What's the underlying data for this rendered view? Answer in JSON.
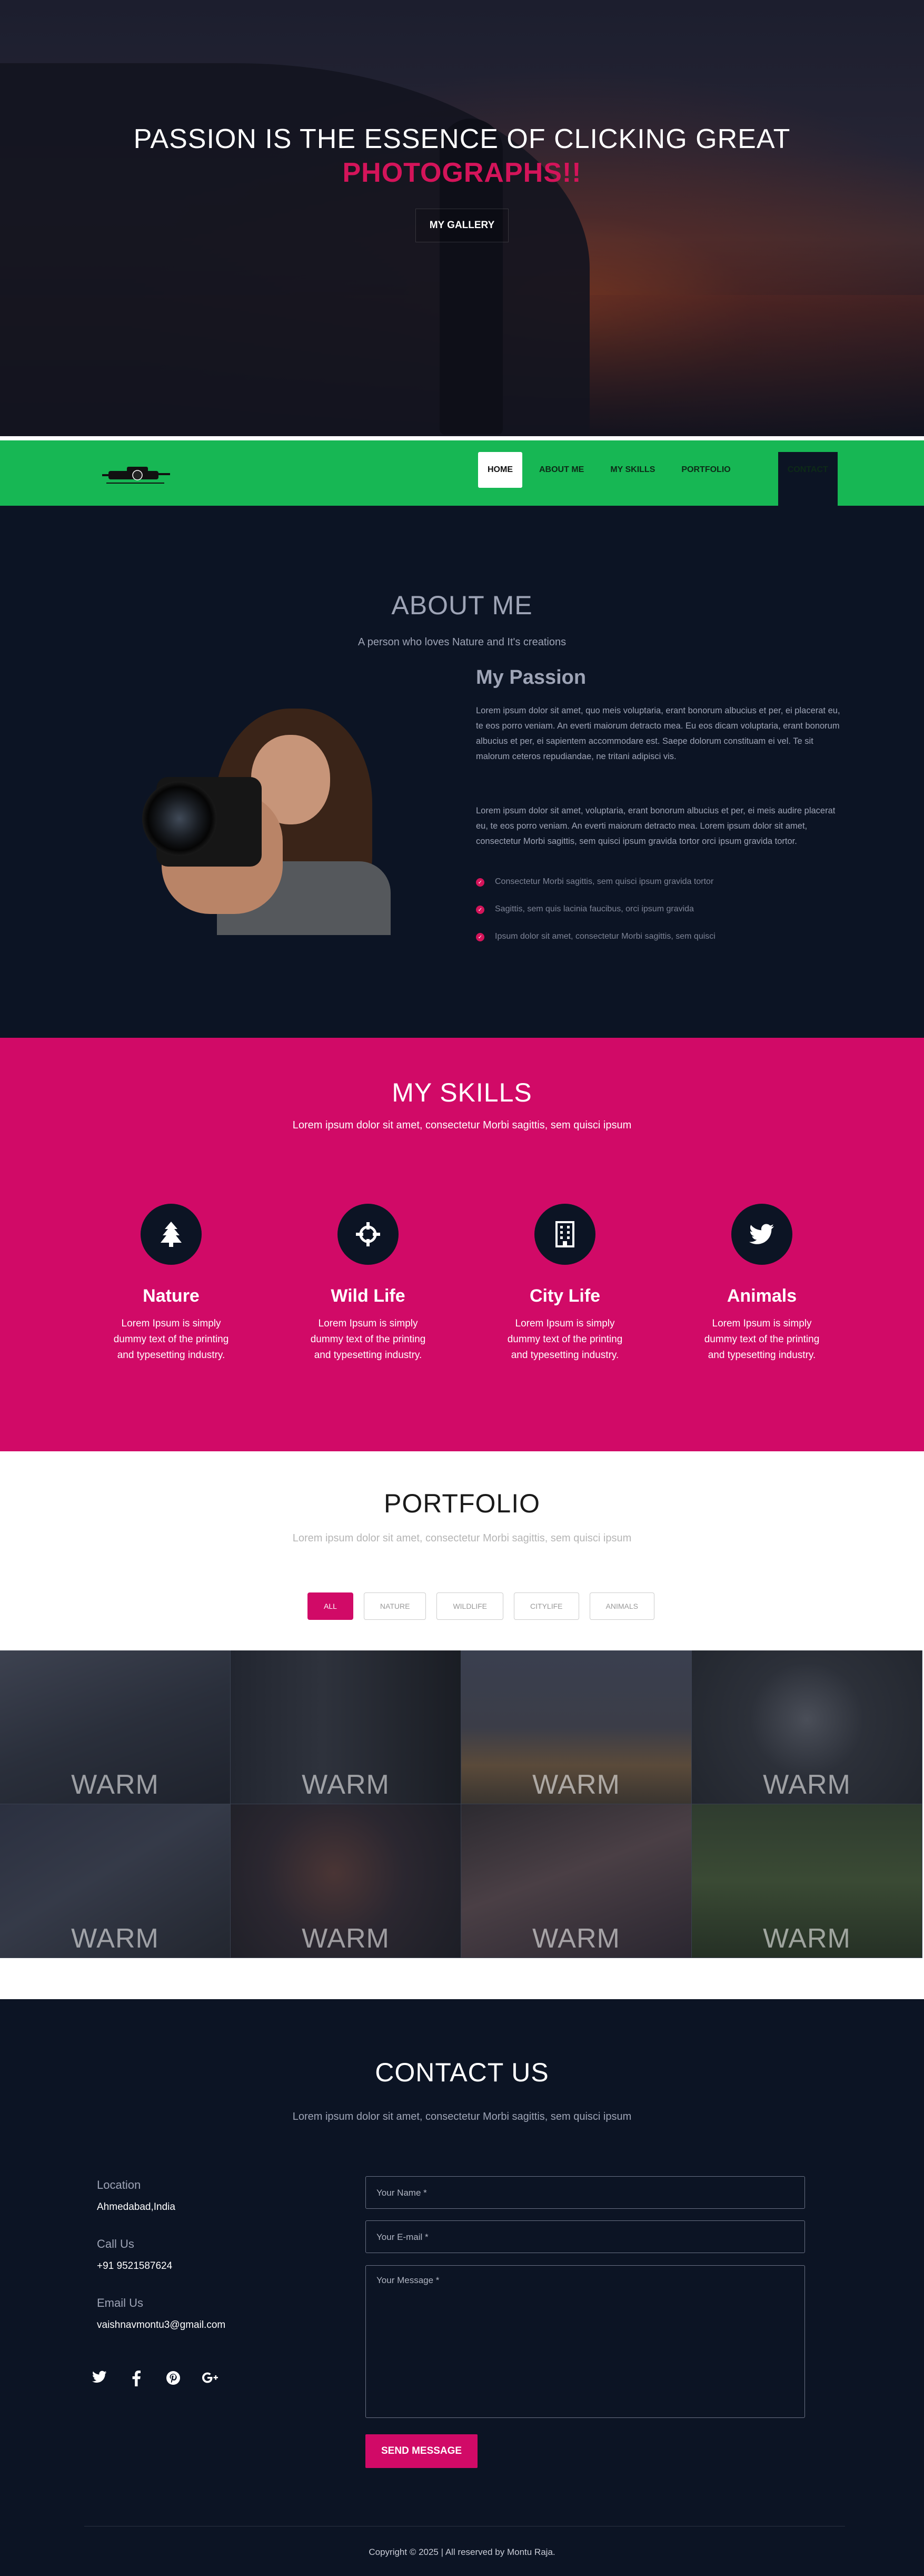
{
  "hero": {
    "line1": "PASSION IS THE ESSENCE OF CLICKING GREAT",
    "line2": "PHOTOGRAPHS!!",
    "button": "MY GALLERY"
  },
  "nav": {
    "items": [
      "HOME",
      "ABOUT ME",
      "MY SKILLS",
      "PORTFOLIO",
      "CONTACT"
    ],
    "active": "HOME"
  },
  "about": {
    "title": "ABOUT ME",
    "subtitle": "A person who loves Nature and It's creations",
    "heading": "My Passion",
    "para1": "Lorem ipsum dolor sit amet, quo meis voluptaria, erant bonorum albucius et per, ei placerat eu, te eos porro veniam. An everti maiorum detracto mea. Eu eos dicam voluptaria, erant bonorum albucius et per, ei sapientem accommodare est. Saepe dolorum constituam ei vel. Te sit malorum ceteros repudiandae, ne tritani adipisci vis.",
    "para2": "Lorem ipsum dolor sit amet, voluptaria, erant bonorum albucius et per, ei meis audire placerat eu, te eos porro veniam. An everti maiorum detracto mea. Lorem ipsum dolor sit amet, consectetur Morbi sagittis, sem quisci ipsum gravida tortor orci ipsum gravida tortor.",
    "checks": [
      "Consectetur Morbi sagittis, sem quisci ipsum gravida tortor",
      "Sagittis, sem quis lacinia faucibus, orci ipsum gravida",
      "Ipsum dolor sit amet, consectetur Morbi sagittis, sem quisci"
    ]
  },
  "skills": {
    "title": "MY SKILLS",
    "subtitle": "Lorem ipsum dolor sit amet, consectetur Morbi sagittis, sem quisci ipsum",
    "items": [
      {
        "title": "Nature",
        "icon": "tree-icon",
        "desc": "Lorem Ipsum is simply dummy text of the printing and typesetting industry."
      },
      {
        "title": "Wild Life",
        "icon": "crosshair-icon",
        "desc": "Lorem Ipsum is simply dummy text of the printing and typesetting industry."
      },
      {
        "title": "City Life",
        "icon": "building-icon",
        "desc": "Lorem Ipsum is simply dummy text of the printing and typesetting industry."
      },
      {
        "title": "Animals",
        "icon": "twitter-bird-icon",
        "desc": "Lorem Ipsum is simply dummy text of the printing and typesetting industry."
      }
    ]
  },
  "portfolio": {
    "title": "PORTFOLIO",
    "subtitle": "Lorem ipsum dolor sit amet, consectetur Morbi sagittis, sem quisci ipsum",
    "filters": [
      "ALL",
      "NATURE",
      "WILDLIFE",
      "CITYLIFE",
      "ANIMALS"
    ],
    "active_filter": "ALL",
    "tiles": [
      "WARM",
      "WARM",
      "WARM",
      "WARM",
      "WARM",
      "WARM",
      "WARM",
      "WARM"
    ]
  },
  "contact": {
    "title": "CONTACT US",
    "subtitle": "Lorem ipsum dolor sit amet, consectetur Morbi sagittis, sem quisci ipsum",
    "location_label": "Location",
    "location": "Ahmedabad,India",
    "call_label": "Call Us",
    "phone": "+91 9521587624",
    "email_label": "Email Us",
    "email": "vaishnavmontu3@gmail.com",
    "name_placeholder": "Your Name *",
    "email_placeholder": "Your E-mail *",
    "message_placeholder": "Your Message *",
    "send": "SEND MESSAGE",
    "socials": [
      "twitter-icon",
      "facebook-icon",
      "pinterest-icon",
      "google-plus-icon"
    ]
  },
  "footer": {
    "copyright": "Copyright © 2025 | All reserved by Montu Raja."
  },
  "colors": {
    "accent": "#d10a67",
    "nav_green": "#17b754",
    "dark": "#0c1424"
  }
}
